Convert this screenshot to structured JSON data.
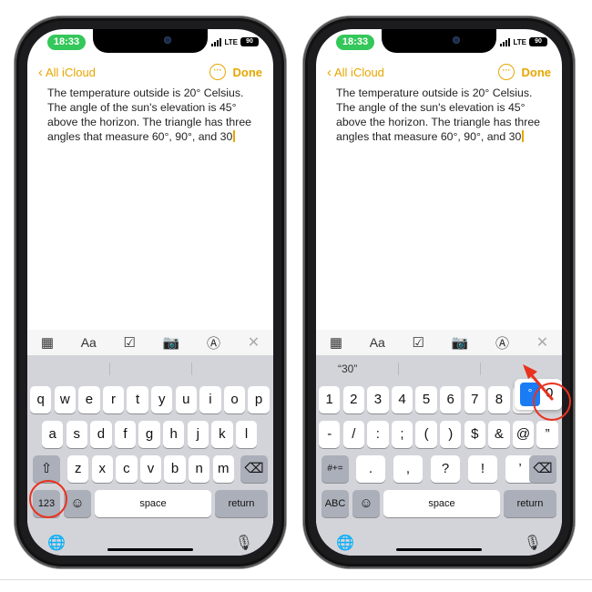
{
  "status": {
    "time": "18:33",
    "network": "LTE",
    "battery": "90"
  },
  "nav": {
    "back_label": "All iCloud",
    "more_glyph": "···",
    "done_label": "Done"
  },
  "note": {
    "text": "The temperature outside is 20° Celsius. The angle of the sun's elevation is 45° above the horizon. The triangle has three angles that measure 60°, 90°, and 30"
  },
  "toolbar": {
    "table_glyph": "▦",
    "format_label": "Aa",
    "checklist_glyph": "☑",
    "camera_glyph": "📷",
    "markup_glyph": "Ⓐ",
    "close_glyph": "✕"
  },
  "keyboard_left": {
    "row1": [
      "q",
      "w",
      "e",
      "r",
      "t",
      "y",
      "u",
      "i",
      "o",
      "p"
    ],
    "row2": [
      "a",
      "s",
      "d",
      "f",
      "g",
      "h",
      "j",
      "k",
      "l"
    ],
    "row3": [
      "z",
      "x",
      "c",
      "v",
      "b",
      "n",
      "m"
    ],
    "shift_glyph": "⇧",
    "delete_glyph": "⌫",
    "numbers_key": "123",
    "emoji_glyph": "☺",
    "space_key": "space",
    "return_key": "return"
  },
  "keyboard_right": {
    "suggestion": "“30”",
    "row1": [
      "1",
      "2",
      "3",
      "4",
      "5",
      "6",
      "7",
      "8",
      "9"
    ],
    "row2": [
      "-",
      "/",
      ":",
      ";",
      "(",
      ")",
      "$",
      "&",
      "@",
      "”"
    ],
    "row3": [
      ".",
      ",",
      "?",
      "!",
      "’"
    ],
    "symbols_key": "#+=",
    "delete_glyph": "⌫",
    "abc_key": "ABC",
    "emoji_glyph": "☺",
    "space_key": "space",
    "return_key": "return",
    "popup": {
      "selected": "°",
      "other": "0"
    }
  },
  "bottom": {
    "globe_glyph": "🌐",
    "mic_glyph": "🎙"
  },
  "colors": {
    "accent": "#e6a600",
    "highlight": "#e8321e",
    "popup_selected": "#1a7cf5",
    "time_pill": "#34c759"
  }
}
